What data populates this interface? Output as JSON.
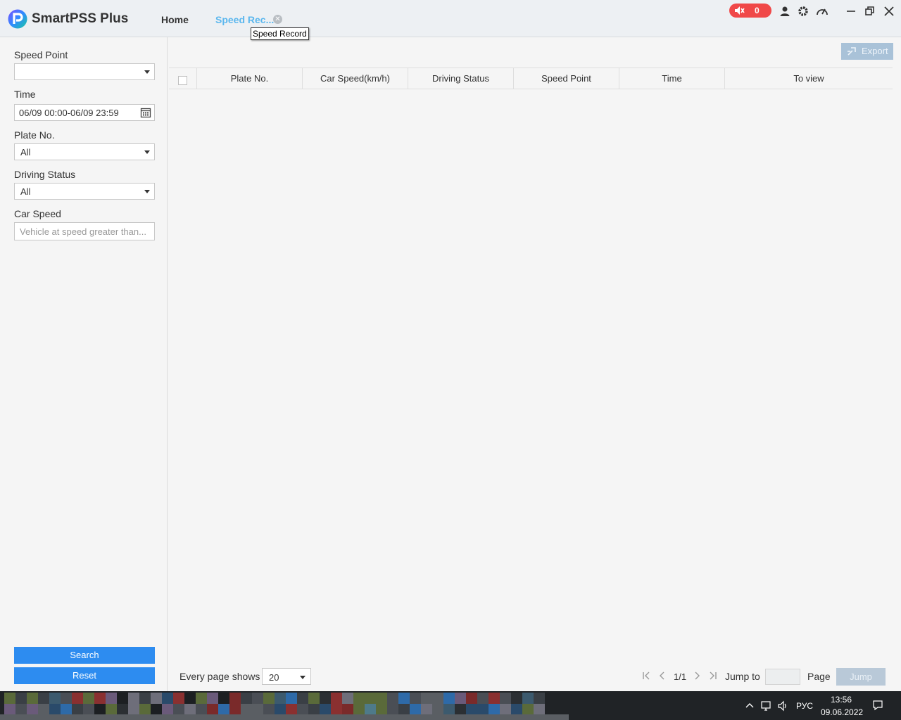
{
  "app": {
    "title": "SmartPSS Plus"
  },
  "tabs": {
    "home": "Home",
    "speed_record": "Speed Rec...",
    "tooltip": "Speed Record"
  },
  "titlebar": {
    "alarm_count": "0"
  },
  "filters": {
    "speed_point_label": "Speed Point",
    "speed_point_value": "",
    "time_label": "Time",
    "time_value": "06/09 00:00-06/09 23:59",
    "plate_label": "Plate No.",
    "plate_value": "All",
    "driving_status_label": "Driving Status",
    "driving_status_value": "All",
    "car_speed_label": "Car Speed",
    "car_speed_placeholder": "Vehicle at speed greater than..."
  },
  "buttons": {
    "search": "Search",
    "reset": "Reset",
    "export": "Export"
  },
  "table": {
    "columns": [
      "Plate No.",
      "Car Speed(km/h)",
      "Driving Status",
      "Speed Point",
      "Time",
      "To view"
    ],
    "rows": []
  },
  "pagination": {
    "every_page_label": "Every page shows",
    "page_size": "20",
    "page_indicator": "1/1",
    "jump_to_label": "Jump to",
    "jump_value": "",
    "page_label": "Page",
    "jump_button": "Jump"
  },
  "taskbar": {
    "language": "РУС",
    "time": "13:56",
    "date": "09.06.2022"
  },
  "colors": {
    "accent": "#2d8cf0",
    "active_tab": "#5bb7ee",
    "alarm": "#f04848"
  }
}
